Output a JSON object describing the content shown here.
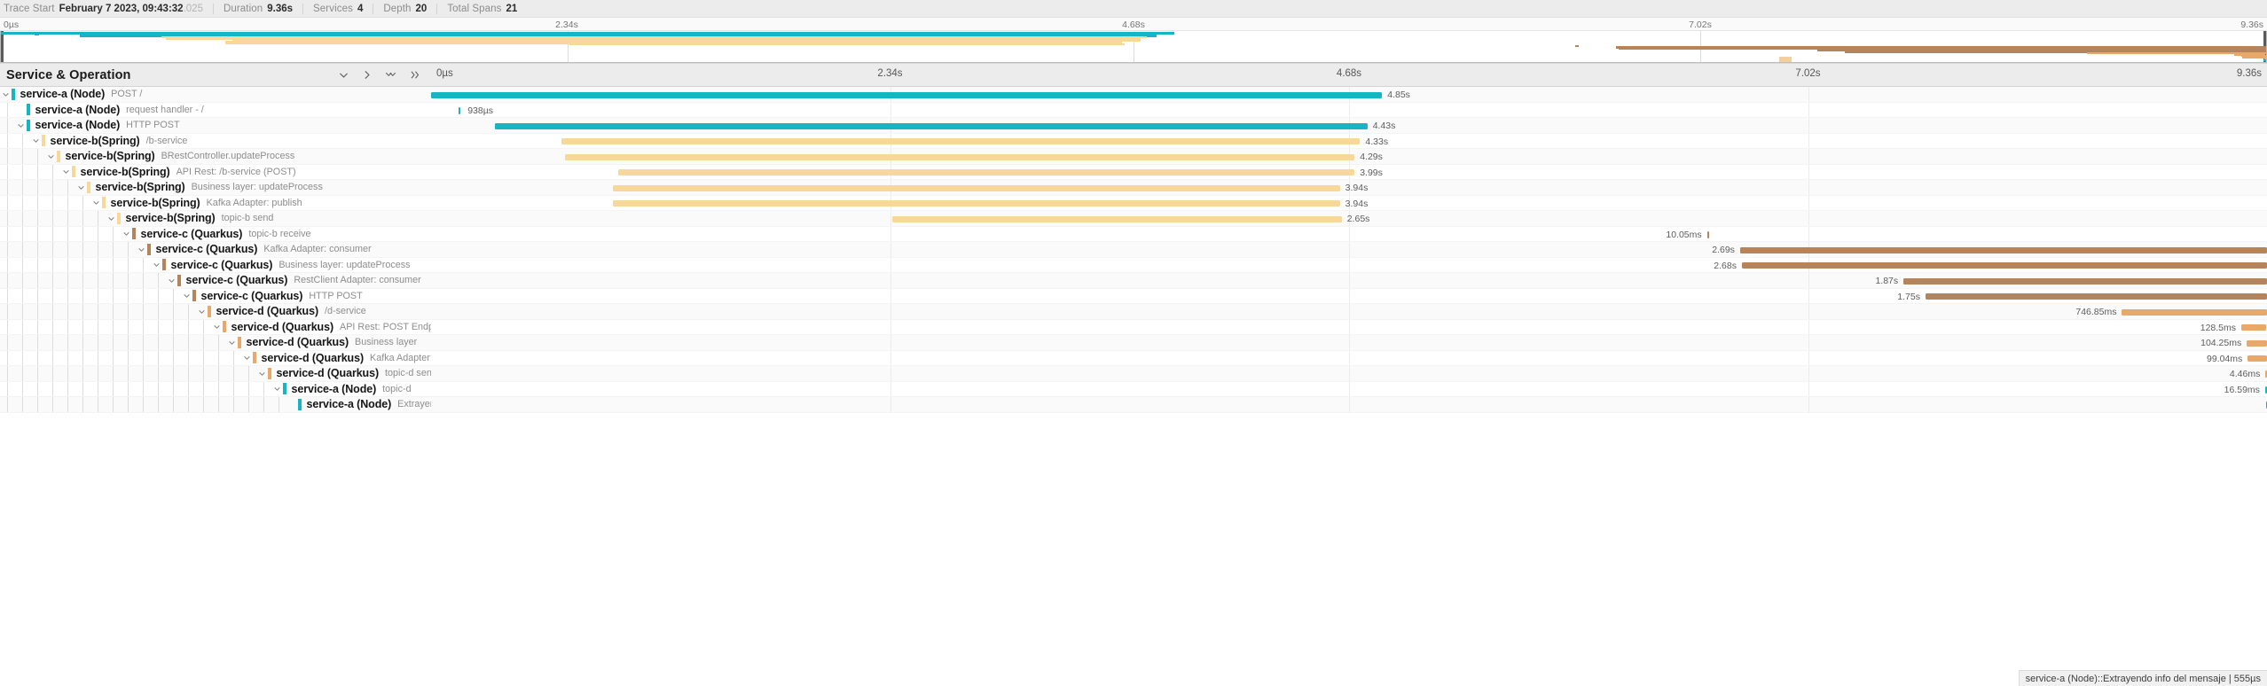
{
  "header": {
    "items": [
      {
        "label": "Trace Start",
        "value": "February 7 2023, 09:43:32",
        "fraction": ".025"
      },
      {
        "label": "Duration",
        "value": "9.36s",
        "fraction": ""
      },
      {
        "label": "Services",
        "value": "4",
        "fraction": ""
      },
      {
        "label": "Depth",
        "value": "20",
        "fraction": ""
      },
      {
        "label": "Total Spans",
        "value": "21",
        "fraction": ""
      }
    ]
  },
  "minimap": {
    "ticks": [
      "0µs",
      "2.34s",
      "4.68s",
      "7.02s",
      "9.36s"
    ]
  },
  "columns": {
    "title": "Service & Operation",
    "actions": [
      {
        "name": "collapse-one-level-icon",
        "glyph": "chevron-down"
      },
      {
        "name": "expand-one-level-icon",
        "glyph": "chevron-right"
      },
      {
        "name": "collapse-all-icon",
        "glyph": "double-chevron-down"
      },
      {
        "name": "expand-all-icon",
        "glyph": "double-chevron-right"
      }
    ],
    "ticks": [
      "0µs",
      "2.34s",
      "4.68s",
      "7.02s",
      "9.36s"
    ]
  },
  "colors": {
    "service_a": "#16b5c4",
    "service_b": "#f7d79a",
    "service_b_bar": "#fbdfa8",
    "service_c": "#b5845b",
    "service_d": "#e8a86a",
    "grid": "#ececec"
  },
  "footer": {
    "tooltip": "service-a (Node)::Extrayendo info del mensaje | 555µs"
  },
  "spans": [
    {
      "depth": 0,
      "service": "service-a (Node)",
      "operation": "POST /",
      "color": "#16b5c4",
      "caret": "down",
      "start_pct": 0.0,
      "width_pct": 51.8,
      "duration": "4.85s",
      "label_side": "right"
    },
    {
      "depth": 1,
      "service": "service-a (Node)",
      "operation": "request handler - /",
      "color": "#16b5c4",
      "caret": "none",
      "start_pct": 1.5,
      "width_pct": 0.2,
      "duration": "938µs",
      "label_side": "right"
    },
    {
      "depth": 1,
      "service": "service-a (Node)",
      "operation": "HTTP POST",
      "color": "#16b5c4",
      "caret": "down",
      "start_pct": 3.5,
      "width_pct": 47.5,
      "duration": "4.43s",
      "label_side": "right"
    },
    {
      "depth": 2,
      "service": "service-b(Spring)",
      "operation": "/b-service",
      "color": "#f7d79a",
      "caret": "down",
      "start_pct": 7.1,
      "width_pct": 43.5,
      "duration": "4.33s",
      "label_side": "right"
    },
    {
      "depth": 3,
      "service": "service-b(Spring)",
      "operation": "BRestController.updateProcess",
      "color": "#f7d79a",
      "caret": "down",
      "start_pct": 7.3,
      "width_pct": 43.0,
      "duration": "4.29s",
      "label_side": "right"
    },
    {
      "depth": 4,
      "service": "service-b(Spring)",
      "operation": "API Rest: /b-service (POST)",
      "color": "#f7d79a",
      "caret": "down",
      "start_pct": 10.2,
      "width_pct": 40.1,
      "duration": "3.99s",
      "label_side": "right"
    },
    {
      "depth": 5,
      "service": "service-b(Spring)",
      "operation": "Business layer: updateProcess",
      "color": "#f7d79a",
      "caret": "down",
      "start_pct": 9.9,
      "width_pct": 39.6,
      "duration": "3.94s",
      "label_side": "right"
    },
    {
      "depth": 6,
      "service": "service-b(Spring)",
      "operation": "Kafka Adapter: publish",
      "color": "#f7d79a",
      "caret": "down",
      "start_pct": 9.9,
      "width_pct": 39.6,
      "duration": "3.94s",
      "label_side": "right"
    },
    {
      "depth": 7,
      "service": "service-b(Spring)",
      "operation": "topic-b send",
      "color": "#f7d79a",
      "caret": "down",
      "start_pct": 25.1,
      "width_pct": 24.5,
      "duration": "2.65s",
      "label_side": "right"
    },
    {
      "depth": 8,
      "service": "service-c (Quarkus)",
      "operation": "topic-b receive",
      "color": "#b5845b",
      "caret": "down",
      "start_pct": 69.5,
      "width_pct": 0.15,
      "duration": "10.05ms",
      "label_side": "left"
    },
    {
      "depth": 9,
      "service": "service-c (Quarkus)",
      "operation": "Kafka Adapter: consumer",
      "color": "#b5845b",
      "caret": "down",
      "start_pct": 71.3,
      "width_pct": 28.7,
      "duration": "2.69s",
      "label_side": "left"
    },
    {
      "depth": 10,
      "service": "service-c (Quarkus)",
      "operation": "Business layer: updateProcess",
      "color": "#b5845b",
      "caret": "down",
      "start_pct": 71.4,
      "width_pct": 28.6,
      "duration": "2.68s",
      "label_side": "left"
    },
    {
      "depth": 11,
      "service": "service-c (Quarkus)",
      "operation": "RestClient Adapter: consumer",
      "color": "#b5845b",
      "caret": "down",
      "start_pct": 80.2,
      "width_pct": 19.8,
      "duration": "1.87s",
      "label_side": "left"
    },
    {
      "depth": 12,
      "service": "service-c (Quarkus)",
      "operation": "HTTP POST",
      "color": "#b5845b",
      "caret": "down",
      "start_pct": 81.4,
      "width_pct": 18.6,
      "duration": "1.75s",
      "label_side": "left"
    },
    {
      "depth": 13,
      "service": "service-d (Quarkus)",
      "operation": "/d-service",
      "color": "#e8a86a",
      "caret": "down",
      "start_pct": 92.1,
      "width_pct": 7.9,
      "duration": "746.85ms",
      "label_side": "left"
    },
    {
      "depth": 14,
      "service": "service-d (Quarkus)",
      "operation": "API Rest: POST Endpoint",
      "color": "#e8a86a",
      "caret": "down",
      "start_pct": 98.6,
      "width_pct": 1.35,
      "duration": "128.5ms",
      "label_side": "left"
    },
    {
      "depth": 15,
      "service": "service-d (Quarkus)",
      "operation": "Business layer",
      "color": "#e8a86a",
      "caret": "down",
      "start_pct": 98.9,
      "width_pct": 1.1,
      "duration": "104.25ms",
      "label_side": "left"
    },
    {
      "depth": 16,
      "service": "service-d (Quarkus)",
      "operation": "Kafka Adapter: publish",
      "color": "#e8a86a",
      "caret": "down",
      "start_pct": 98.95,
      "width_pct": 1.05,
      "duration": "99.04ms",
      "label_side": "left"
    },
    {
      "depth": 17,
      "service": "service-d (Quarkus)",
      "operation": "topic-d send",
      "color": "#e8a86a",
      "caret": "down",
      "start_pct": 99.92,
      "width_pct": 0.08,
      "duration": "4.46ms",
      "label_side": "left"
    },
    {
      "depth": 18,
      "service": "service-a (Node)",
      "operation": "topic-d",
      "color": "#16b5c4",
      "caret": "down",
      "start_pct": 99.9,
      "width_pct": 0.12,
      "duration": "16.59ms",
      "label_side": "left"
    },
    {
      "depth": 19,
      "service": "service-a (Node)",
      "operation": "Extrayendo info del mensaje",
      "color": "#16b5c4",
      "caret": "none",
      "start_pct": 99.95,
      "width_pct": 0.05,
      "duration": "",
      "label_side": "left"
    }
  ]
}
